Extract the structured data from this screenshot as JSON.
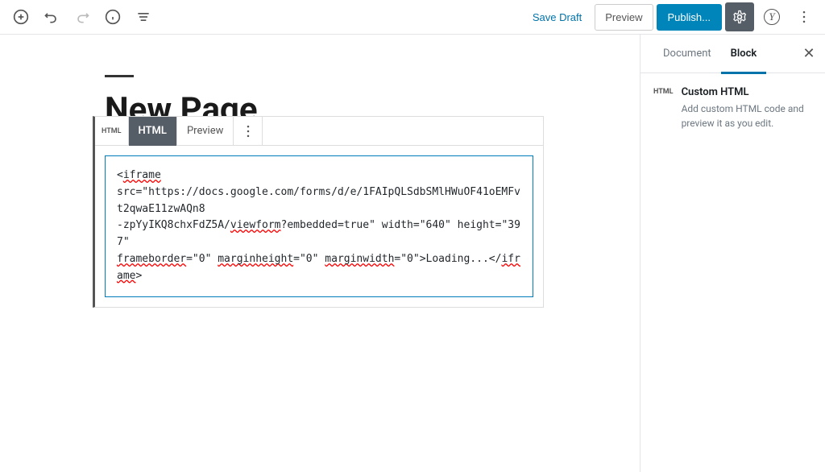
{
  "toolbar": {
    "saveDraft": "Save Draft",
    "preview": "Preview",
    "publish": "Publish..."
  },
  "editor": {
    "pageTitle": "New Page",
    "blockToolbar": {
      "iconLabel": "HTML",
      "htmlTab": "HTML",
      "previewTab": "Preview"
    },
    "codeContent": {
      "line1_start": "<",
      "line1_iframe": "iframe",
      "line2_src": "src=\"https://docs.google.com/forms/d/e/1FAIpQLSdbSMlHWuOF41oEMFvt2qwaE11zwAQn8",
      "line3_part1": "-zpYyIKQ8chxFdZ5A/",
      "line3_viewform": "viewform",
      "line3_part2": "?embedded=true\" width=\"640\" height=\"397\" ",
      "line4_frameborder": "frameborder",
      "line4_part1": "=\"0\" ",
      "line4_marginheight": "marginheight",
      "line4_part2": "=\"0\" ",
      "line4_marginwidth": "marginwidth",
      "line4_part3": "=\"0\">Loading...</",
      "line4_iframe": "iframe",
      "line4_end": ">"
    }
  },
  "sidebar": {
    "tabs": {
      "document": "Document",
      "block": "Block"
    },
    "blockInfo": {
      "iconLabel": "HTML",
      "title": "Custom HTML",
      "description": "Add custom HTML code and preview it as you edit."
    }
  }
}
